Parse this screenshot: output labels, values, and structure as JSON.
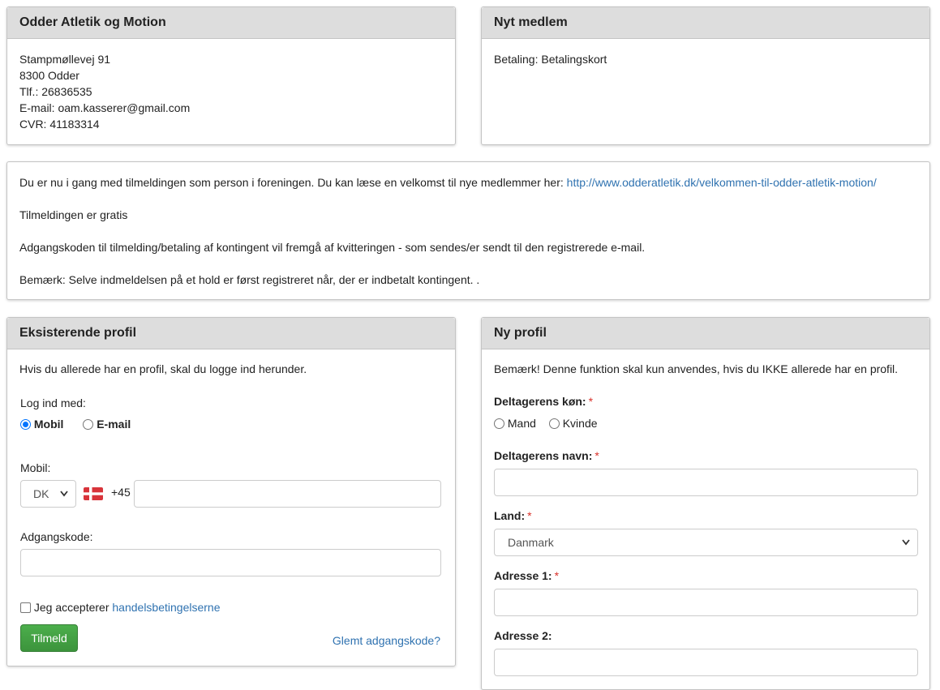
{
  "club": {
    "title": "Odder Atletik og Motion",
    "address": "Stampmøllevej 91",
    "city": "8300 Odder",
    "phone": "Tlf.: 26836535",
    "email": "E-mail: oam.kasserer@gmail.com",
    "cvr": "CVR: 41183314"
  },
  "new_member": {
    "title": "Nyt medlem",
    "payment": "Betaling: Betalingskort"
  },
  "info": {
    "intro": "Du er nu i gang med tilmeldingen som person i foreningen. Du kan læse en velkomst til nye medlemmer her:",
    "link": "http://www.odderatletik.dk/velkommen-til-odder-atletik-motion/",
    "free": "Tilmeldingen er gratis",
    "password_note": "Adgangskoden til tilmelding/betaling af kontingent vil fremgå af kvitteringen - som sendes/er sendt til den registrerede e-mail.",
    "remark": "Bemærk: Selve indmeldelsen på et hold er først registreret når, der er indbetalt kontingent. ."
  },
  "existing": {
    "title": "Eksisterende profil",
    "intro": "Hvis du allerede har en profil, skal du logge ind herunder.",
    "login_with": "Log ind med:",
    "opt_mobile": "Mobil",
    "opt_email": "E-mail",
    "selected": "Mobil",
    "mobile_label": "Mobil:",
    "country_code": "DK",
    "dial_prefix": "+45",
    "mobile_value": "",
    "password_label": "Adgangskode:",
    "password_value": "",
    "accept_prefix": "Jeg accepterer",
    "accept_link": "handelsbetingelserne",
    "submit": "Tilmeld",
    "forgot": "Glemt adgangskode?"
  },
  "new_profile": {
    "title": "Ny profil",
    "notice": "Bemærk! Denne funktion skal kun anvendes, hvis du IKKE allerede har en profil.",
    "gender_label": "Deltagerens køn:",
    "gender_male": "Mand",
    "gender_female": "Kvinde",
    "name_label": "Deltagerens navn:",
    "name_value": "",
    "country_label": "Land:",
    "country_value": "Danmark",
    "address1_label": "Adresse 1:",
    "address1_value": "",
    "address2_label": "Adresse 2:",
    "address2_value": "",
    "required_mark": "*"
  },
  "icons": {
    "flag": "denmark-flag-icon",
    "chevron": "chevron-down-icon"
  },
  "colors": {
    "heading_bg": "#dddddd",
    "link": "#2f72b0",
    "required": "#d9322b",
    "button": "#3f9b3f",
    "radio_checked": "#0075ff"
  }
}
